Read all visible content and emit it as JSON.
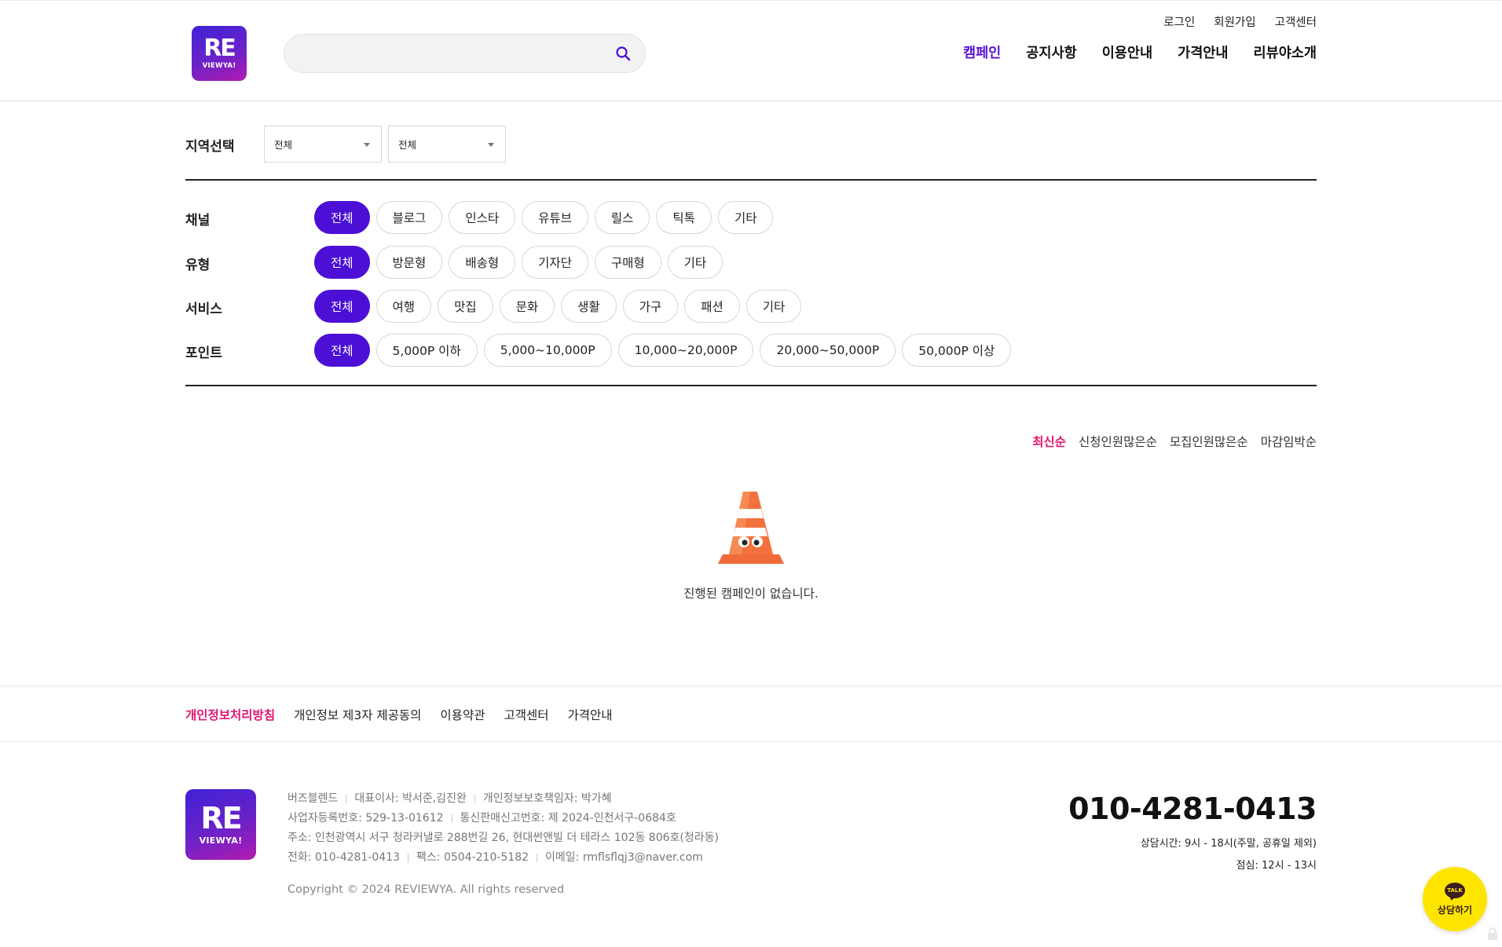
{
  "header": {
    "logo": {
      "top": "RE",
      "bottom": "VIEWYA!"
    },
    "search": {
      "placeholder": ""
    },
    "util_links": [
      "로그인",
      "회원가입",
      "고객센터"
    ],
    "nav": [
      {
        "label": "캠페인",
        "active": true
      },
      {
        "label": "공지사항",
        "active": false
      },
      {
        "label": "이용안내",
        "active": false
      },
      {
        "label": "가격안내",
        "active": false
      },
      {
        "label": "리뷰야소개",
        "active": false
      }
    ]
  },
  "region": {
    "label": "지역선택",
    "select1": "전체",
    "select2": "전체"
  },
  "filters": {
    "channel": {
      "label": "채널",
      "options": [
        "전체",
        "블로그",
        "인스타",
        "유튜브",
        "릴스",
        "틱톡",
        "기타"
      ]
    },
    "type": {
      "label": "유형",
      "options": [
        "전체",
        "방문형",
        "배송형",
        "기자단",
        "구매형",
        "기타"
      ]
    },
    "service": {
      "label": "서비스",
      "options": [
        "전체",
        "여행",
        "맛집",
        "문화",
        "생활",
        "가구",
        "패션",
        "기타"
      ]
    },
    "point": {
      "label": "포인트",
      "options": [
        "전체",
        "5,000P 이하",
        "5,000~10,000P",
        "10,000~20,000P",
        "20,000~50,000P",
        "50,000P 이상"
      ]
    }
  },
  "sort": [
    "최신순",
    "신청인원많은순",
    "모집인원많은순",
    "마감임박순"
  ],
  "empty": {
    "message": "진행된 캠페인이 없습니다."
  },
  "footer": {
    "links": [
      "개인정보처리방침",
      "개인정보 제3자 제공동의",
      "이용약관",
      "고객센터",
      "가격안내"
    ],
    "company": {
      "row1": [
        "버즈블렌드",
        "대표이사: 박서준,김진완",
        "개인정보보호책임자: 박가혜"
      ],
      "row2": [
        "사업자등록번호: 529-13-01612",
        "통신판매신고번호: 제 2024-인천서구-0684호"
      ],
      "row3": [
        "주소: 인천광역시 서구 청라커낼로 288번길 26, 현대썬앤빌 더 테라스 102동 806호(청라동)"
      ],
      "row4": [
        "전화: 010-4281-0413",
        "팩스: 0504-210-5182",
        "이메일: rmflsflqj3@naver.com"
      ]
    },
    "copyright": "Copyright © 2024 REVIEWYA. All rights reserved",
    "phone": "010-4281-0413",
    "hours": "상담시간: 9시 - 18시(주말, 공휴일 제외)",
    "lunch": "점심: 12시 - 13시"
  },
  "talk": {
    "badge": "TALK",
    "label": "상담하기"
  },
  "colors": {
    "accent": "#4b0fd6",
    "highlight": "#e3166e",
    "kakao": "#fee500"
  }
}
